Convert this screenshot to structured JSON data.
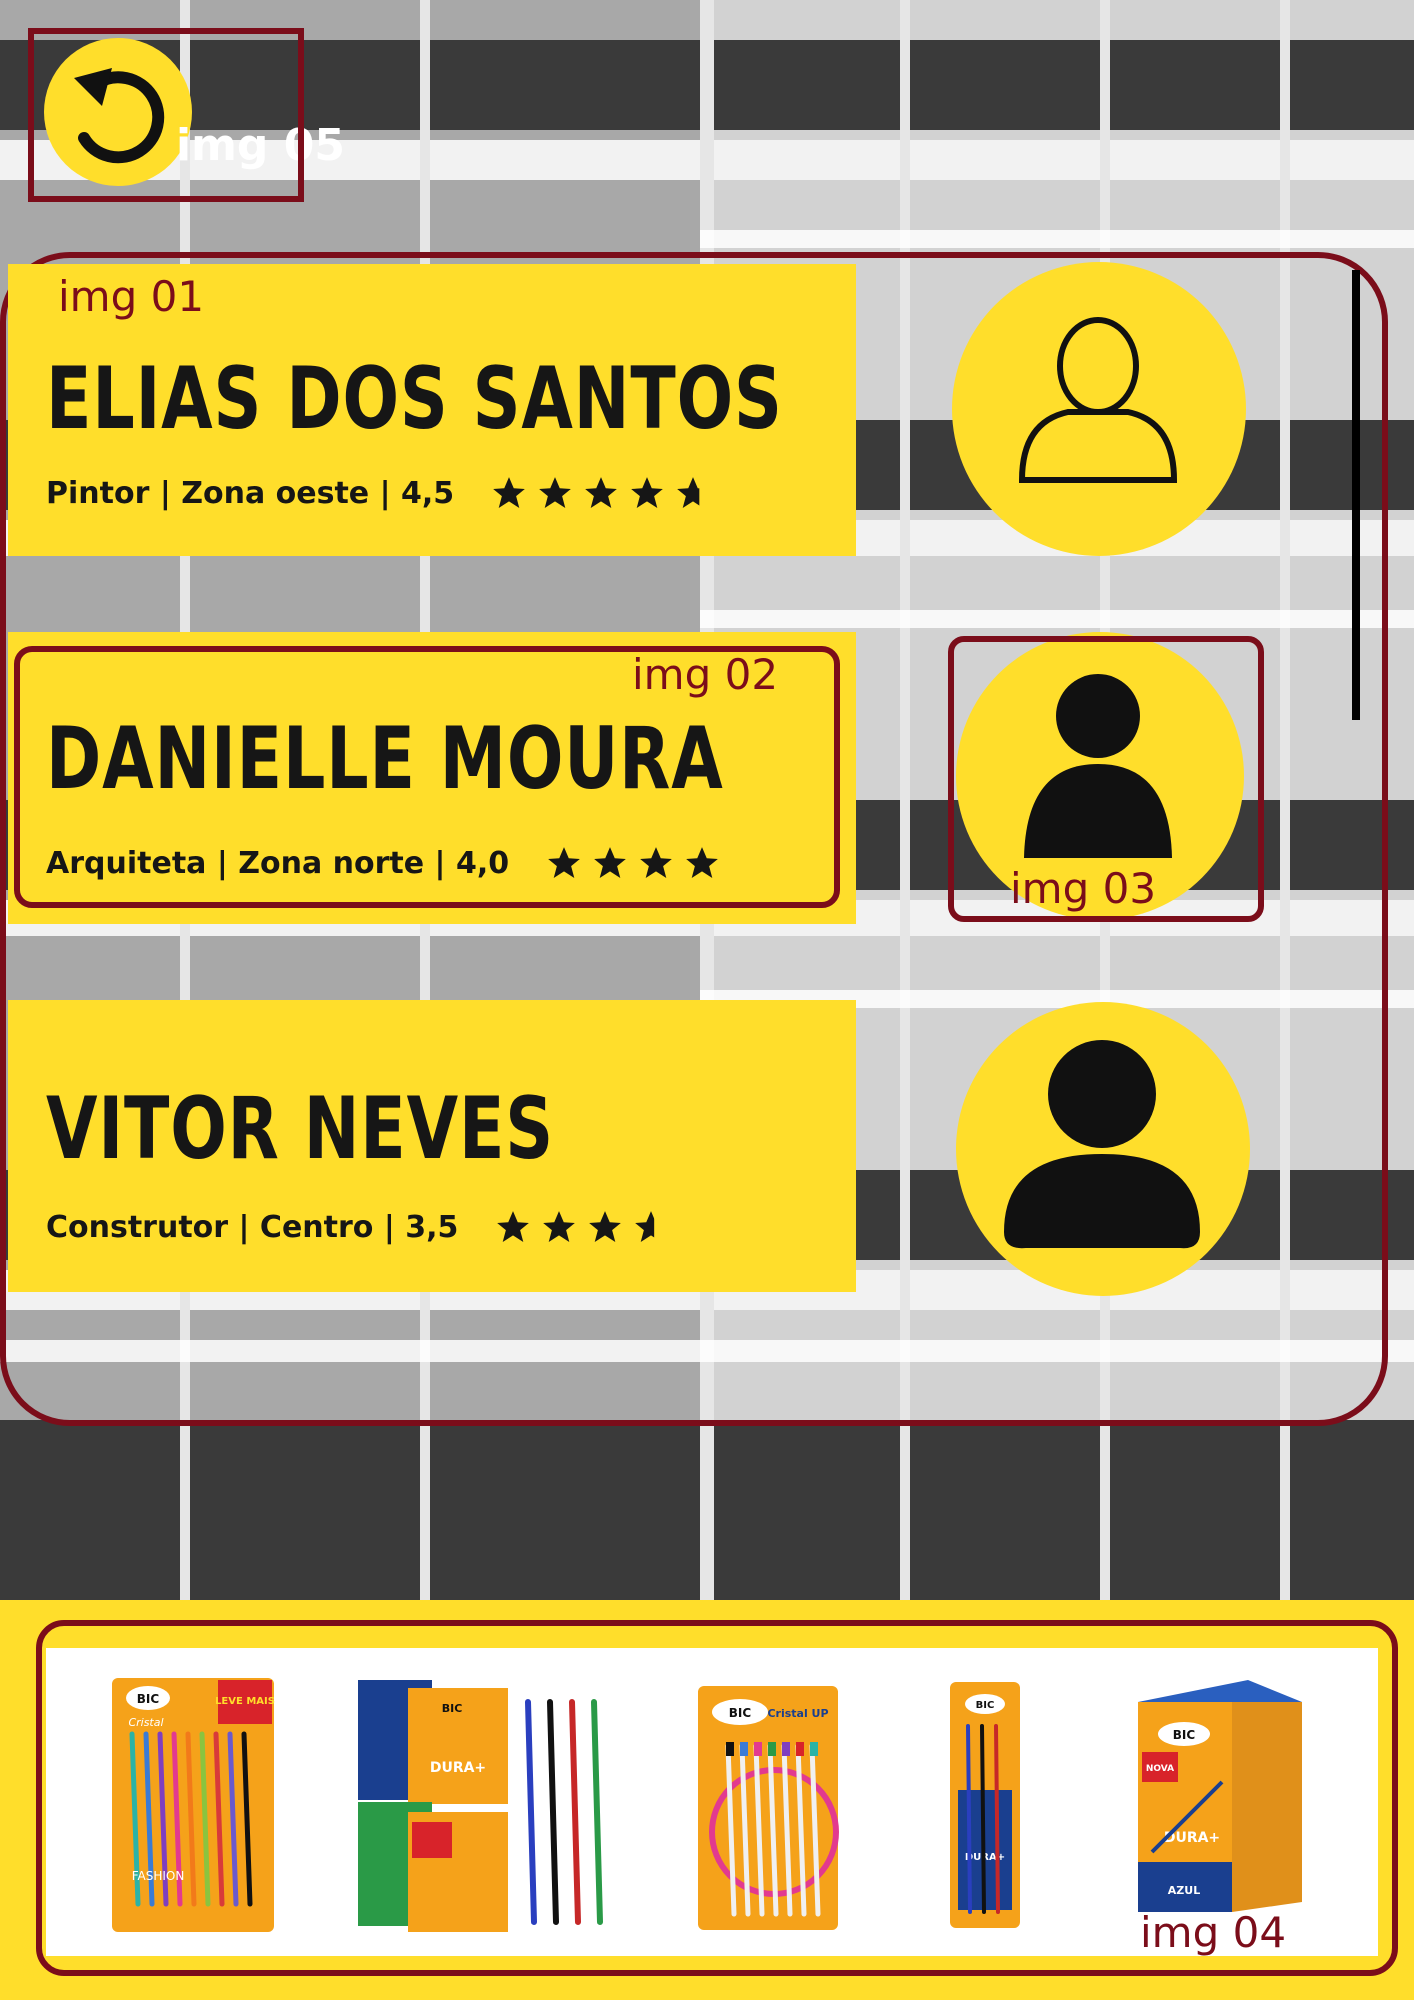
{
  "back": {
    "label": "img 05",
    "icon": "undo-arrow-icon"
  },
  "annotations": {
    "list_area": "img 01",
    "card_highlight": "img 02",
    "avatar_highlight": "img 03",
    "products_area": "img 04"
  },
  "profiles": [
    {
      "name": "ELIAS DOS SANTOS",
      "meta": "Pintor | Zona oeste | 4,5",
      "rating": 4.5,
      "avatar_icon": "user-outline-icon"
    },
    {
      "name": "DANIELLE MOURA",
      "meta": "Arquiteta | Zona norte | 4,0",
      "rating": 4.0,
      "avatar_icon": "user-filled-icon"
    },
    {
      "name": "VITOR NEVES",
      "meta": "Construtor | Centro | 3,5",
      "rating": 3.5,
      "avatar_icon": "user-filled-icon"
    }
  ],
  "products": [
    {
      "brand": "BIC",
      "line": "Cristal",
      "badge": "LEVE MAIS",
      "sub": "FASHION"
    },
    {
      "brand": "BIC",
      "line": "DURA+",
      "badge": "",
      "sub": ""
    },
    {
      "brand": "BIC",
      "line": "Cristal UP",
      "badge": "",
      "sub": ""
    },
    {
      "brand": "BIC",
      "line": "DURA+",
      "badge": "",
      "sub": ""
    },
    {
      "brand": "BIC",
      "line": "DURA+",
      "badge": "NOVA",
      "sub": "AZUL"
    }
  ],
  "colors": {
    "accent": "#ffde2b",
    "annotation": "#7b0d1a",
    "text": "#161616"
  }
}
